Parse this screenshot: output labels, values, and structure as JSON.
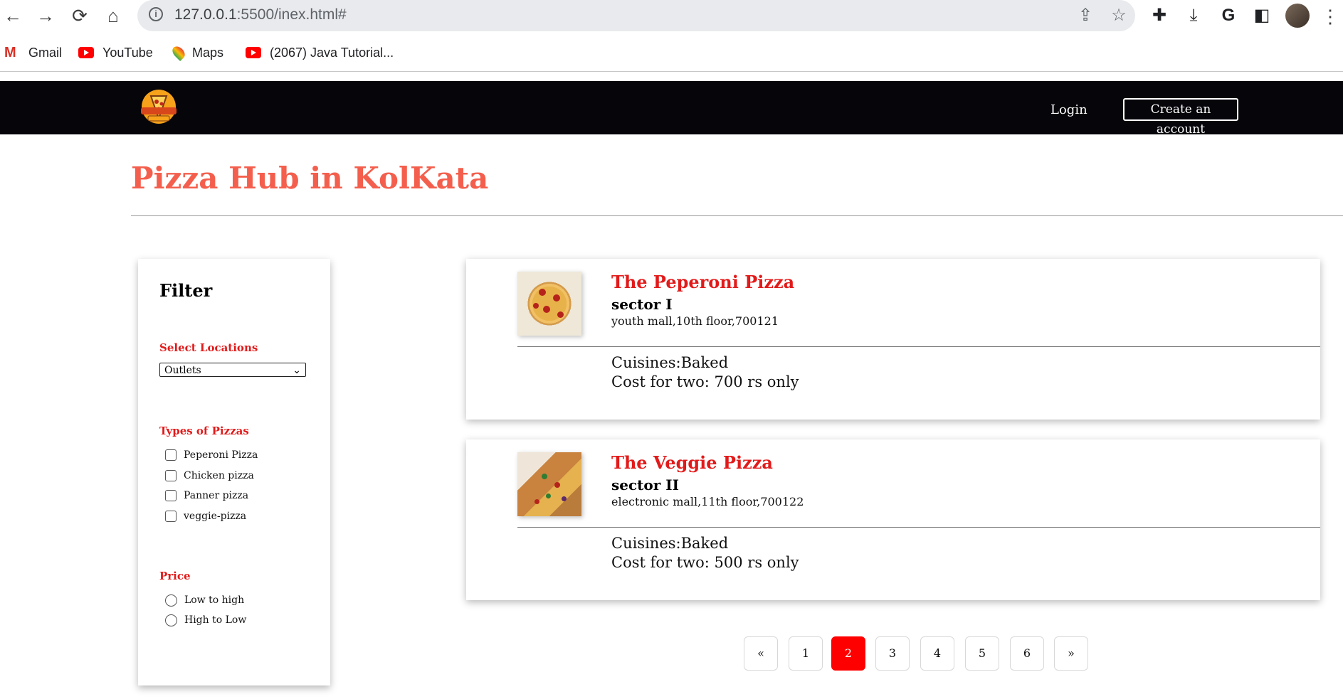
{
  "browser": {
    "url_host": "127.0.0.1",
    "url_rest": ":5500/inex.html#",
    "bookmarks": [
      {
        "label": "Gmail"
      },
      {
        "label": "YouTube"
      },
      {
        "label": "Maps"
      },
      {
        "label": "(2067) Java Tutorial..."
      }
    ]
  },
  "nav": {
    "login": "Login",
    "create_account": "Create an account"
  },
  "page": {
    "title": "Pizza Hub in KolKata"
  },
  "filter": {
    "heading": "Filter",
    "locations_label": "Select Locations",
    "locations_selected": "Outlets",
    "types_label": "Types of Pizzas",
    "types": [
      "Peperoni Pizza",
      "Chicken pizza",
      "Panner pizza",
      "veggie-pizza"
    ],
    "price_label": "Price",
    "price_options": [
      "Low to high",
      "High to Low"
    ]
  },
  "results": [
    {
      "name": "The Peperoni Pizza",
      "sector": "sector I",
      "address": "youth mall,10th floor,700121",
      "cuisine": "Cuisines:Baked",
      "cost": "Cost for two: 700 rs only"
    },
    {
      "name": "The Veggie Pizza",
      "sector": "sector II",
      "address": "electronic mall,11th floor,700122",
      "cuisine": "Cuisines:Baked",
      "cost": "Cost for two: 500 rs only"
    }
  ],
  "pagination": {
    "prev": "«",
    "pages": [
      "1",
      "2",
      "3",
      "4",
      "5",
      "6"
    ],
    "current": "2",
    "next": "»"
  }
}
